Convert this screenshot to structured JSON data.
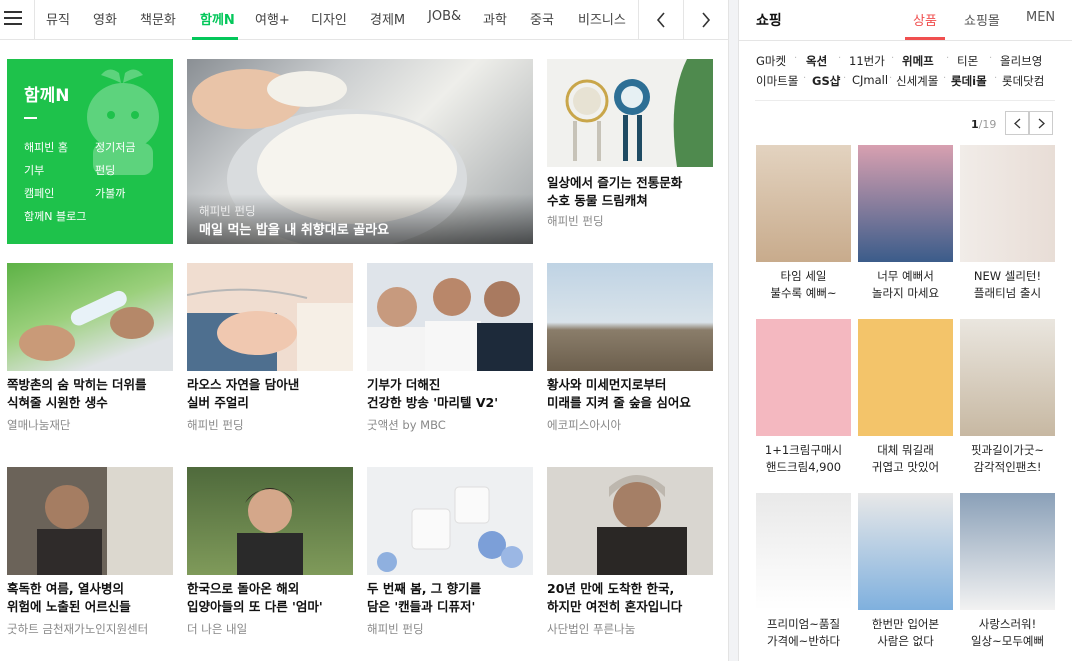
{
  "nav": {
    "tabs": [
      "뮤직",
      "영화",
      "책문화",
      "함께N",
      "여행+",
      "디자인",
      "경제M",
      "JOB&",
      "과학",
      "중국",
      "비즈니스"
    ],
    "active_tab": "함께N",
    "prev_icon": "chevron-left-icon",
    "next_icon": "chevron-right-icon",
    "menu_icon": "hamburger-menu-icon",
    "accent_color": "#03c75a"
  },
  "promo": {
    "title": "함께N",
    "links": [
      "해피빈 홈",
      "정기저금",
      "기부",
      "펀딩",
      "캠페인",
      "가볼까",
      "함께N 블로그"
    ],
    "bg_color": "#1ec24b"
  },
  "feature": {
    "source": "해피빈 펀딩",
    "title": "매일 먹는 밥을 내 취향대로 골라요"
  },
  "cards": [
    {
      "title1": "일상에서 즐기는 전통문화",
      "title2": "수호 동물 드림캐쳐",
      "source": "해피빈 펀딩"
    },
    {
      "title1": "쪽방촌의 숨 막히는 더위를",
      "title2": "식혀줄 시원한 생수",
      "source": "열매나눔재단"
    },
    {
      "title1": "라오스 자연을 담아낸",
      "title2": "실버 주얼리",
      "source": "해피빈 펀딩"
    },
    {
      "title1": "기부가 더해진",
      "title2": "건강한 방송 '마리텔 V2'",
      "source": "굿액션 by MBC"
    },
    {
      "title1": "황사와 미세먼지로부터",
      "title2": "미래를 지켜 줄 숲을 심어요",
      "source": "에코피스아시아"
    },
    {
      "title1": "혹독한 여름, 열사병의",
      "title2": "위험에 노출된 어르신들",
      "source": "굿하트 금천재가노인지원센터"
    },
    {
      "title1": "한국으로 돌아온 해외",
      "title2": "입양아들의 또 다른 '엄마'",
      "source": "더 나은 내일"
    },
    {
      "title1": "두 번째 봄, 그 향기를",
      "title2": "담은 '캔들과 디퓨저'",
      "source": "해피빈 펀딩"
    },
    {
      "title1": "20년 만에 도착한 한국,",
      "title2": "하지만 여전히 혼자입니다",
      "source": "사단법인 푸른나눔"
    }
  ],
  "shopping": {
    "title": "쇼핑",
    "tabs": [
      "상품",
      "쇼핑몰",
      "MEN"
    ],
    "active_tab": "상품",
    "accent_color": "#f04f4f",
    "malls_row1": [
      "G마켓",
      "옥션",
      "11번가",
      "위메프",
      "티몬",
      "올리브영"
    ],
    "malls_row2": [
      "이마트몰",
      "GS샵",
      "CJmall",
      "신세계몰",
      "롯데i몰",
      "롯데닷컴"
    ],
    "page_current": "1",
    "page_total": "/19",
    "products": [
      {
        "l1": "타임 세일",
        "l2": "불수록 예뻐~"
      },
      {
        "l1": "너무 예뻐서",
        "l2": "놀라지 마세요"
      },
      {
        "l1": "NEW 셀리턴!",
        "l2": "플래티넘 출시"
      },
      {
        "l1": "1+1크림구매시",
        "l2": "핸드크림4,900"
      },
      {
        "l1": "대체 뭐길래",
        "l2": "귀엽고 맛있어"
      },
      {
        "l1": "핏과길이가굿~",
        "l2": "감각적인팬츠!"
      },
      {
        "l1": "프리미엄~품질",
        "l2": "가격에~반하다"
      },
      {
        "l1": "한번만 입어본",
        "l2": "사람은 없다"
      },
      {
        "l1": "사랑스러워!",
        "l2": "일상~모두예뻐"
      }
    ]
  }
}
